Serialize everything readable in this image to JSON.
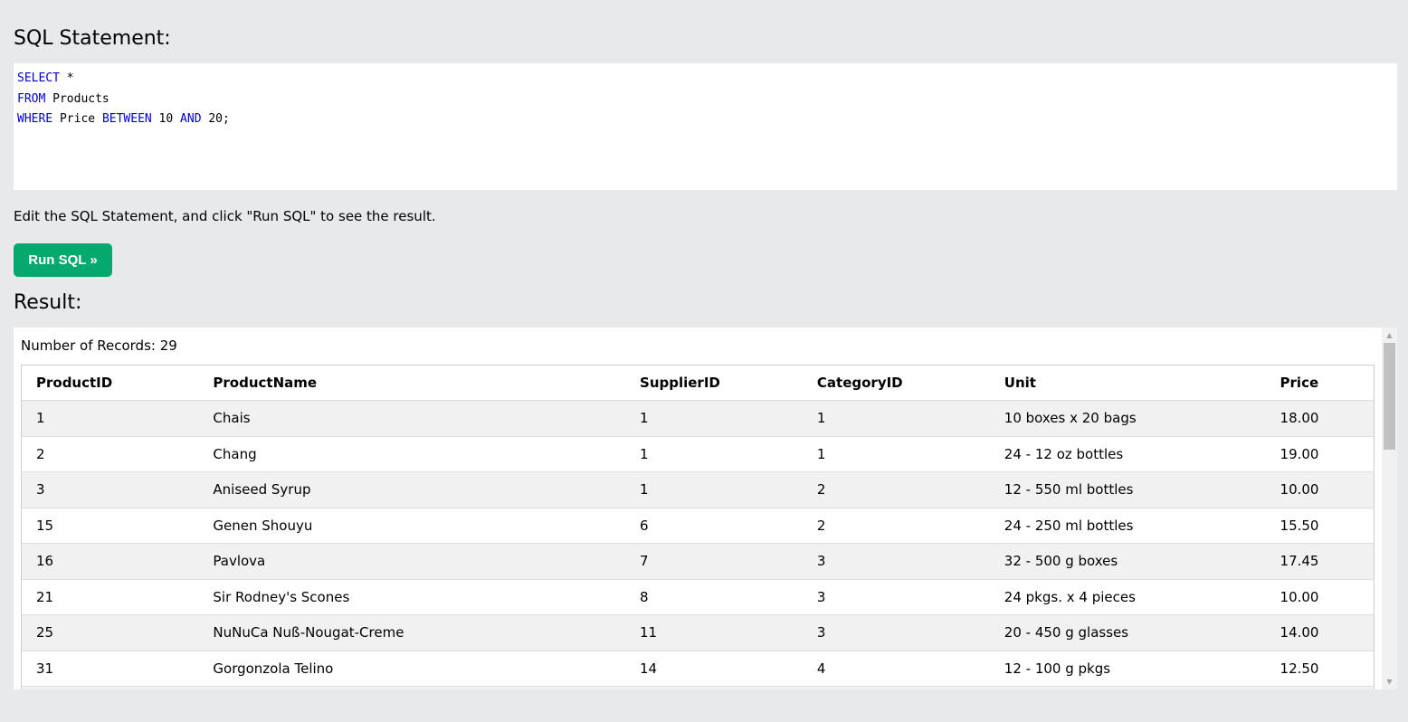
{
  "sql_title": "SQL Statement:",
  "sql": {
    "line1_kw": "SELECT",
    "line1_rest": " *",
    "line2_kw": "FROM",
    "line2_rest": " Products",
    "line3_kw1": "WHERE",
    "line3_mid1": " Price ",
    "line3_kw2": "BETWEEN",
    "line3_mid2": " 10 ",
    "line3_kw3": "AND",
    "line3_rest": " 20;"
  },
  "hint": "Edit the SQL Statement, and click \"Run SQL\" to see the result.",
  "run_button": "Run SQL »",
  "result_title": "Result:",
  "record_count": "Number of Records: 29",
  "columns": [
    "ProductID",
    "ProductName",
    "SupplierID",
    "CategoryID",
    "Unit",
    "Price"
  ],
  "rows": [
    [
      "1",
      "Chais",
      "1",
      "1",
      "10 boxes x 20 bags",
      "18.00"
    ],
    [
      "2",
      "Chang",
      "1",
      "1",
      "24 - 12 oz bottles",
      "19.00"
    ],
    [
      "3",
      "Aniseed Syrup",
      "1",
      "2",
      "12 - 550 ml bottles",
      "10.00"
    ],
    [
      "15",
      "Genen Shouyu",
      "6",
      "2",
      "24 - 250 ml bottles",
      "15.50"
    ],
    [
      "16",
      "Pavlova",
      "7",
      "3",
      "32 - 500 g boxes",
      "17.45"
    ],
    [
      "21",
      "Sir Rodney's Scones",
      "8",
      "3",
      "24 pkgs. x 4 pieces",
      "10.00"
    ],
    [
      "25",
      "NuNuCa Nuß-Nougat-Creme",
      "11",
      "3",
      "20 - 450 g glasses",
      "14.00"
    ],
    [
      "31",
      "Gorgonzola Telino",
      "14",
      "4",
      "12 - 100 g pkgs",
      "12.50"
    ],
    [
      "",
      "",
      "",
      "",
      "",
      ""
    ]
  ],
  "colors": {
    "run_button": "#04aa6d",
    "keyword": "#0000cd",
    "background": "#e7e9eb"
  }
}
